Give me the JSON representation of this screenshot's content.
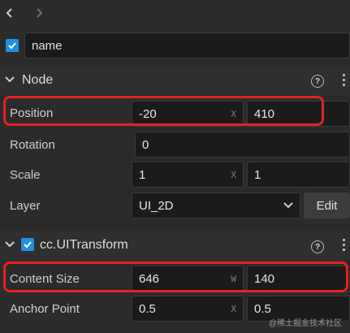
{
  "name_field": {
    "value": "name",
    "enabled": true
  },
  "node_section": {
    "title": "Node"
  },
  "position": {
    "label": "Position",
    "x": "-20",
    "y": "410",
    "x_unit": "X"
  },
  "rotation": {
    "label": "Rotation",
    "value": "0"
  },
  "scale": {
    "label": "Scale",
    "x": "1",
    "y": "1",
    "x_unit": "X"
  },
  "layer": {
    "label": "Layer",
    "value": "UI_2D",
    "edit_label": "Edit"
  },
  "uitransform_section": {
    "title": "cc.UITransform",
    "enabled": true
  },
  "content_size": {
    "label": "Content Size",
    "w": "646",
    "h": "140",
    "w_unit": "W"
  },
  "anchor_point": {
    "label": "Anchor Point",
    "x": "0.5",
    "y": "0.5",
    "x_unit": "X"
  },
  "watermark": "@稀土掘金技术社区",
  "colors": {
    "accent": "#1e90e6",
    "highlight": "#e52121",
    "background": "#2b2b2b",
    "field": "#1b1b1b"
  }
}
